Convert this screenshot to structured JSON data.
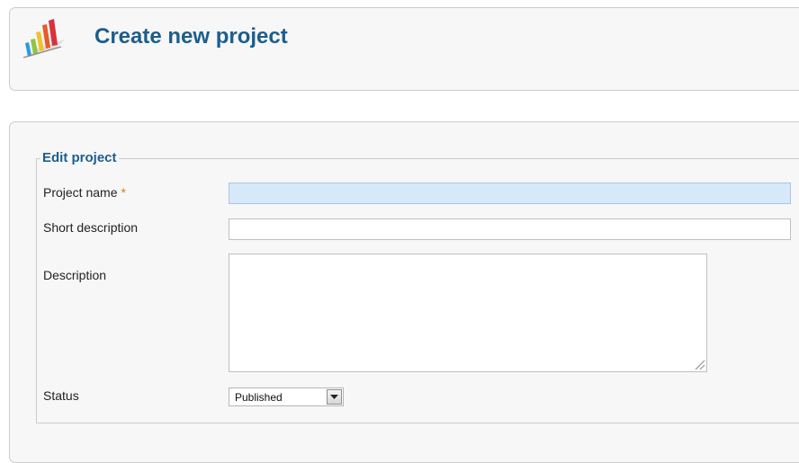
{
  "header": {
    "title": "Create new project",
    "icon": "project-chart-icon"
  },
  "form": {
    "legend": "Edit project",
    "fields": {
      "project_name": {
        "label": "Project name",
        "required_marker": "*",
        "value": ""
      },
      "short_description": {
        "label": "Short description",
        "value": ""
      },
      "description": {
        "label": "Description",
        "value": ""
      },
      "status": {
        "label": "Status",
        "selected": "Published"
      }
    }
  },
  "colors": {
    "title": "#1c5e8c",
    "required": "#e07a10",
    "focused_input": "#d6e9f9",
    "panel_bg": "#f7f7f7",
    "panel_border": "#cccccc"
  }
}
